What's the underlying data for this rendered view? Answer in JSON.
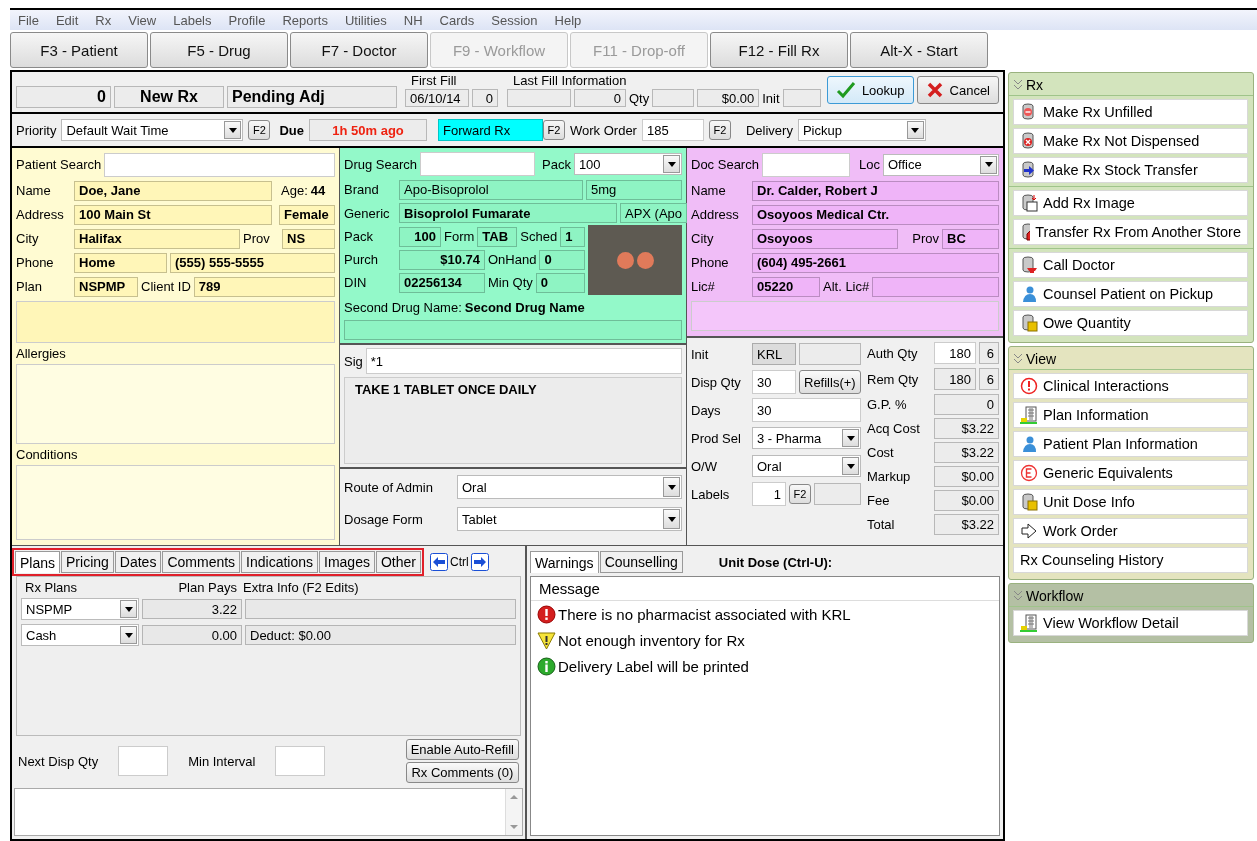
{
  "menu": [
    "File",
    "Edit",
    "Rx",
    "View",
    "Labels",
    "Profile",
    "Reports",
    "Utilities",
    "NH",
    "Cards",
    "Session",
    "Help"
  ],
  "toolbar": [
    {
      "label": "F3 - Patient",
      "disabled": false
    },
    {
      "label": "F5 - Drug",
      "disabled": false
    },
    {
      "label": "F7 - Doctor",
      "disabled": false
    },
    {
      "label": "F9 - Workflow",
      "disabled": true
    },
    {
      "label": "F11 - Drop-off",
      "disabled": true
    },
    {
      "label": "F12 - Fill Rx",
      "disabled": false
    },
    {
      "label": "Alt-X - Start",
      "disabled": false
    }
  ],
  "header": {
    "rx_number": "0",
    "rx_type": "New Rx",
    "status": "Pending Adj",
    "first_fill_label": "First Fill",
    "first_fill_date": "06/10/14",
    "first_fill_count": "0",
    "last_fill_label": "Last Fill Information",
    "last_fill_count": "0",
    "qty_label": "Qty",
    "amount": "$0.00",
    "init_label": "Init"
  },
  "actions": [
    {
      "kind": "lookup",
      "label": "Lookup"
    },
    {
      "kind": "cancel",
      "label": "Cancel"
    }
  ],
  "order": {
    "priority_label": "Priority",
    "priority": "Default Wait Time",
    "priority_key": "F2",
    "due_label": "Due",
    "due": "1h 50m ago",
    "forward": "Forward Rx",
    "forward_key": "F2",
    "work_order_label": "Work Order",
    "work_order": "185",
    "work_order_key": "F2",
    "delivery_label": "Delivery",
    "delivery": "Pickup"
  },
  "patient": {
    "search_label": "Patient Search",
    "name_label": "Name",
    "name": "Doe, Jane",
    "age_label": "Age:",
    "age": "44",
    "address_label": "Address",
    "address": "100 Main St",
    "gender": "Female",
    "city_label": "City",
    "city": "Halifax",
    "prov_label": "Prov",
    "prov": "NS",
    "phone_label": "Phone",
    "phone_type": "Home",
    "phone": "(555) 555-5555",
    "plan_label": "Plan",
    "plan": "NSPMP",
    "client_id_label": "Client ID",
    "client_id": "789",
    "allergies_label": "Allergies",
    "conditions_label": "Conditions"
  },
  "drug": {
    "search_label": "Drug Search",
    "pack_label": "Pack",
    "pack": "100",
    "brand_label": "Brand",
    "brand": "Apo-Bisoprolol",
    "strength": "5mg",
    "generic_label": "Generic",
    "generic": "Bisoprolol Fumarate",
    "manufacturer": "APX (Apo",
    "pack_size_label": "Pack",
    "pack_size": "100",
    "form_label": "Form",
    "form": "TAB",
    "sched_label": "Sched",
    "sched": "1",
    "purch_label": "Purch",
    "purch": "$10.74",
    "onhand_label": "OnHand",
    "onhand": "0",
    "din_label": "DIN",
    "din": "02256134",
    "min_qty_label": "Min Qty",
    "min_qty": "0",
    "second_name_label": "Second Drug Name:",
    "second_name": "Second Drug Name"
  },
  "sig": {
    "label": "Sig",
    "code": "*1",
    "text": "TAKE 1 TABLET ONCE DAILY",
    "route_label": "Route of Admin",
    "route": "Oral",
    "dosage_label": "Dosage Form",
    "dosage": "Tablet"
  },
  "doctor": {
    "search_label": "Doc Search",
    "loc_label": "Loc",
    "loc": "Office",
    "name_label": "Name",
    "name": "Dr. Calder, Robert J",
    "address_label": "Address",
    "address": "Osoyoos Medical Ctr.",
    "city_label": "City",
    "city": "Osoyoos",
    "prov_label": "Prov",
    "prov": "BC",
    "phone_label": "Phone",
    "phone": "(604) 495-2661",
    "lic_label": "Lic#",
    "lic": "05220",
    "alt_lic_label": "Alt. Lic#"
  },
  "dispense": {
    "init_label": "Init",
    "init": "KRL",
    "disp_qty_label": "Disp Qty",
    "disp_qty": "30",
    "refills": "Refills(+)",
    "days_label": "Days",
    "days": "30",
    "prod_sel_label": "Prod Sel",
    "prod_sel": "3 - Pharma",
    "ow_label": "O/W",
    "ow": "Oral",
    "labels_label": "Labels",
    "labels": "1",
    "labels_key": "F2",
    "auth_qty_label": "Auth Qty",
    "auth_qty": "180",
    "auth_refills": "6",
    "rem_qty_label": "Rem Qty",
    "rem_qty": "180",
    "rem_refills": "6"
  },
  "pricing": [
    {
      "label": "G.P. %",
      "value": "0"
    },
    {
      "label": "Acq Cost",
      "value": "$3.22"
    },
    {
      "label": "Cost",
      "value": "$3.22"
    },
    {
      "label": "Markup",
      "value": "$0.00"
    },
    {
      "label": "Fee",
      "value": "$0.00"
    },
    {
      "label": "Total",
      "value": "$3.22"
    }
  ],
  "plan_tabs": [
    {
      "label": "Plans",
      "selected": true
    },
    {
      "label": "Pricing",
      "selected": false
    },
    {
      "label": "Dates",
      "selected": false
    },
    {
      "label": "Comments",
      "selected": false
    },
    {
      "label": "Indications",
      "selected": false
    },
    {
      "label": "Images",
      "selected": false
    },
    {
      "label": "Other",
      "selected": false
    }
  ],
  "tab_nav_label": "Ctrl",
  "plans": {
    "columns": [
      "Rx Plans",
      "Plan Pays",
      "Extra Info (F2 Edits)"
    ],
    "rows": [
      {
        "plan": "NSPMP",
        "pays": "3.22"
      },
      {
        "plan": "Cash",
        "pays": "0.00",
        "extra": "Deduct: $0.00"
      }
    ],
    "next_disp_label": "Next Disp Qty",
    "min_interval_label": "Min Interval",
    "buttons": [
      "Enable Auto-Refill",
      "Rx Comments (0)"
    ]
  },
  "message_tabs": [
    {
      "label": "Warnings",
      "selected": true
    },
    {
      "label": "Counselling",
      "selected": false
    }
  ],
  "unit_dose_label": "Unit Dose (Ctrl-U):",
  "messages": {
    "column": "Message",
    "items": [
      {
        "kind": "error",
        "text": "There is no pharmacist associated with KRL"
      },
      {
        "kind": "warning",
        "text": "Not enough inventory for Rx"
      },
      {
        "kind": "info",
        "text": "Delivery Label will be printed"
      }
    ]
  },
  "side": [
    {
      "title": "Rx",
      "color": "#d3e4bd",
      "groups": [
        [
          {
            "kind": "unfilled",
            "label": "Make Rx Unfilled"
          },
          {
            "kind": "not-dispensed",
            "label": "Make Rx Not Dispensed"
          },
          {
            "kind": "stock-transfer",
            "label": "Make Rx Stock Transfer"
          }
        ],
        [
          {
            "kind": "add-image",
            "label": "Add Rx Image"
          },
          {
            "kind": "transfer-store",
            "label": "Transfer Rx From Another Store"
          }
        ],
        [
          {
            "kind": "call-doctor",
            "label": "Call Doctor"
          },
          {
            "kind": "person",
            "label": "Counsel Patient on Pickup"
          },
          {
            "kind": "owe",
            "label": "Owe Quantity"
          }
        ]
      ]
    },
    {
      "title": "View",
      "color": "#e4e4bf",
      "groups": [
        [
          {
            "kind": "clinical",
            "label": "Clinical Interactions"
          },
          {
            "kind": "grid",
            "label": "Plan Information"
          },
          {
            "kind": "person",
            "label": "Patient Plan Information"
          },
          {
            "kind": "generic",
            "label": "Generic Equivalents"
          },
          {
            "kind": "owe",
            "label": "Unit Dose Info"
          },
          {
            "kind": "work-order",
            "label": "Work Order"
          },
          {
            "kind": "none",
            "label": "Rx Counseling History"
          }
        ]
      ]
    },
    {
      "title": "Workflow",
      "color": "#b4c0a4",
      "groups": [
        [
          {
            "kind": "grid",
            "label": "View Workflow Detail"
          }
        ]
      ]
    }
  ]
}
